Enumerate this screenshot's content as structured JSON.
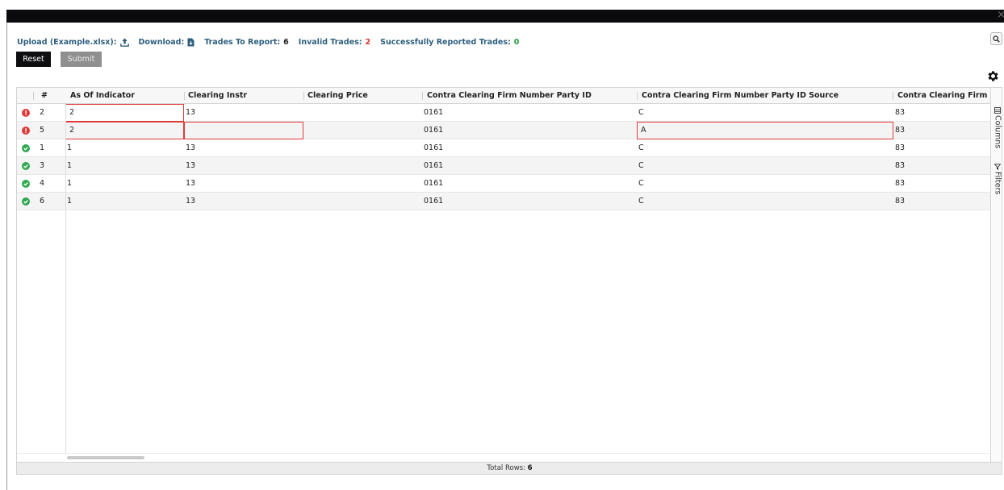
{
  "toolbar": {
    "upload_label": "Upload (Example.xlsx):",
    "download_label": "Download:",
    "trades_to_report_label": "Trades To Report:",
    "trades_to_report_value": "6",
    "invalid_trades_label": "Invalid Trades:",
    "invalid_trades_value": "2",
    "success_label": "Successfully Reported Trades:",
    "success_value": "0"
  },
  "buttons": {
    "reset": "Reset",
    "submit": "Submit"
  },
  "icons": {
    "upload": "upload-icon",
    "download": "file-download-icon",
    "search": "search-icon",
    "settings": "gear-icon",
    "error": "error-circle-icon",
    "success": "check-circle-icon"
  },
  "colors": {
    "error": "#e23a3a",
    "success": "#2fa84f",
    "accent": "#2e5f7f"
  },
  "grid": {
    "headers": {
      "num": "#",
      "as_of": "As Of Indicator",
      "clearing_instr": "Clearing Instr",
      "clearing_price": "Clearing Price",
      "contra_id": "Contra Clearing Firm Number Party ID",
      "contra_src": "Contra Clearing Firm Number Party ID Source",
      "contra_trunc": "Contra Clearing Firm"
    },
    "rows": [
      {
        "status": "error",
        "num": "2",
        "as_of": "2",
        "clearing_instr": "13",
        "clearing_price": "",
        "contra_id": "0161",
        "contra_src": "C",
        "contra_trunc": "83"
      },
      {
        "status": "error",
        "num": "5",
        "as_of": "2",
        "clearing_instr": "",
        "clearing_price": "",
        "contra_id": "0161",
        "contra_src": "A",
        "contra_trunc": "83"
      },
      {
        "status": "ok",
        "num": "1",
        "as_of": "1",
        "clearing_instr": "13",
        "clearing_price": "",
        "contra_id": "0161",
        "contra_src": "C",
        "contra_trunc": "83"
      },
      {
        "status": "ok",
        "num": "3",
        "as_of": "1",
        "clearing_instr": "13",
        "clearing_price": "",
        "contra_id": "0161",
        "contra_src": "C",
        "contra_trunc": "83"
      },
      {
        "status": "ok",
        "num": "4",
        "as_of": "1",
        "clearing_instr": "13",
        "clearing_price": "",
        "contra_id": "0161",
        "contra_src": "C",
        "contra_trunc": "83"
      },
      {
        "status": "ok",
        "num": "6",
        "as_of": "1",
        "clearing_instr": "13",
        "clearing_price": "",
        "contra_id": "0161",
        "contra_src": "C",
        "contra_trunc": "83"
      }
    ],
    "side_tabs": {
      "columns": "Columns",
      "filters": "Filters"
    },
    "footer_label": "Total Rows:",
    "footer_value": "6"
  }
}
